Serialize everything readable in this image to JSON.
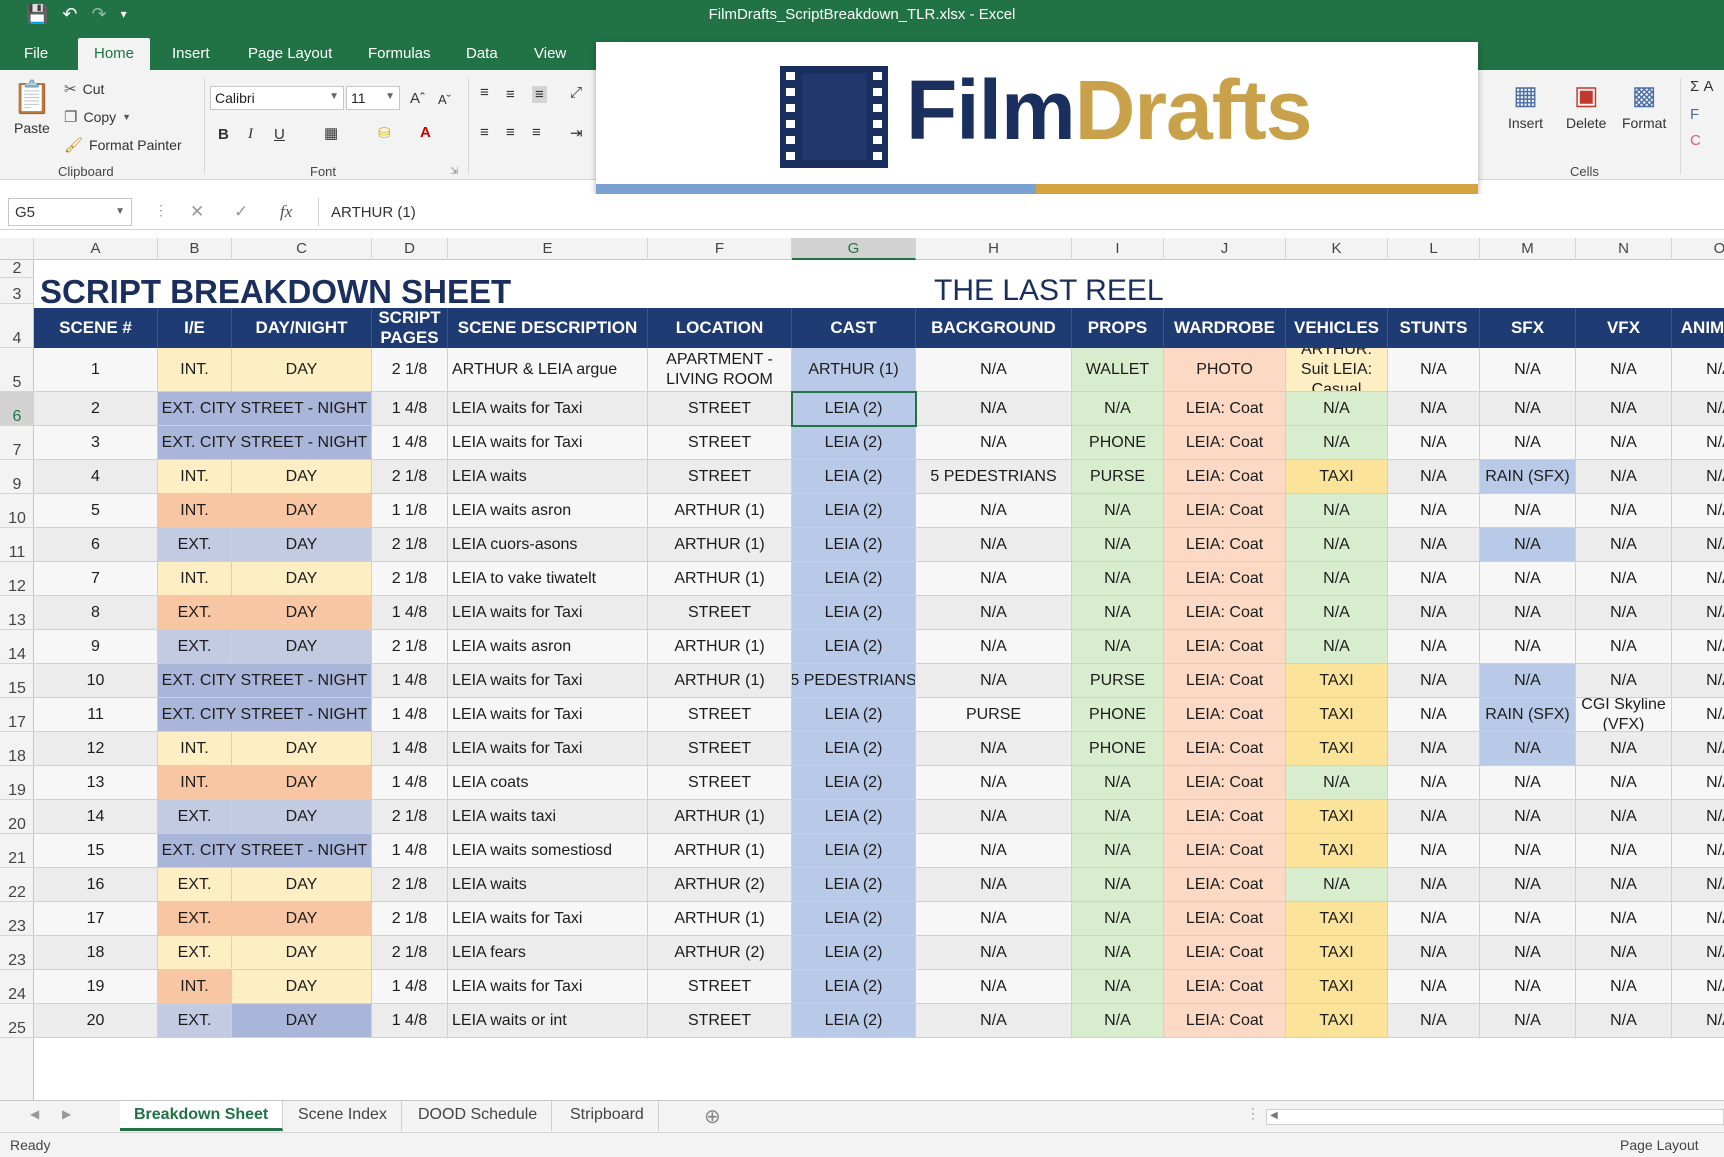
{
  "window": {
    "title": "FilmDrafts_ScriptBreakdown_TLR.xlsx - Excel"
  },
  "quick_access": {
    "save_icon": "save-icon",
    "undo_icon": "undo-icon",
    "redo_icon": "redo-icon",
    "customize_icon": "customize-icon"
  },
  "ribbon_tabs": [
    "File",
    "Home",
    "Insert",
    "Page Layout",
    "Formulas",
    "Data",
    "View"
  ],
  "ribbon": {
    "paste": "Paste",
    "cut": "Cut",
    "copy": "Copy",
    "format_painter": "Format Painter",
    "clipboard_group": "Clipboard",
    "font_name": "Calibri",
    "font_size": "11",
    "font_group": "Font",
    "bold": "B",
    "italic": "I",
    "underline": "U",
    "insert": "Insert",
    "delete": "Delete",
    "format": "Format",
    "cells_group": "Cells",
    "sum": "Σ A",
    "fill": "F",
    "clear": "C"
  },
  "logo": {
    "film": "Film",
    "drafts": "Drafts",
    "film_color": "#1b2f5e",
    "drafts_color": "#c9a14a",
    "bar_left_color": "#7aa1cf",
    "bar_right_color": "#d4a340"
  },
  "formula_bar": {
    "name_box": "G5",
    "fx": "fx",
    "formula": "ARTHUR (1)"
  },
  "columns": [
    "A",
    "B",
    "C",
    "D",
    "E",
    "F",
    "G",
    "H",
    "I",
    "J",
    "K",
    "L",
    "M",
    "N",
    "O"
  ],
  "selected_column": "G",
  "row_numbers": [
    "2",
    "3",
    "4",
    "5",
    "6",
    "7",
    "9",
    "10",
    "11",
    "12",
    "13",
    "14",
    "15",
    "17",
    "18",
    "19",
    "20",
    "21",
    "22",
    "23",
    "23",
    "24",
    "25"
  ],
  "selected_row": "6",
  "sheet": {
    "title": "SCRIPT BREAKDOWN SHEET",
    "production": "THE LAST REEL",
    "headers": [
      "SCENE #",
      "I/E",
      "DAY/NIGHT",
      "SCRIPT PAGES",
      "SCENE DESCRIPTION",
      "LOCATION",
      "CAST",
      "BACKGROUND",
      "PROPS",
      "WARDROBE",
      "VEHICLES",
      "STUNTS",
      "SFX",
      "VFX",
      "ANIMALS"
    ],
    "rows": [
      {
        "scene": "1",
        "ie": "INT.",
        "dn": "DAY",
        "pages": "2 1/8",
        "desc": "ARTHUR & LEIA argue",
        "loc": "APARTMENT - LIVING ROOM",
        "cast": "ARTHUR (1)",
        "bg": "N/A",
        "props": "WALLET",
        "ward": "PHOTO",
        "veh": "ARTHUR: Suit LEIA: Casual",
        "stunts": "N/A",
        "sfx": "N/A",
        "vfx": "N/A",
        "animals": "N/A",
        "ie_color": "#fdeec3",
        "dn_color": "#fdeec3",
        "veh_color": "#fdeec3",
        "sfx_color": ""
      },
      {
        "scene": "2",
        "ie": "EXT. CITY STREET - NIGHT",
        "dn": "",
        "pages": "1 4/8",
        "desc": "LEIA waits for Taxi",
        "loc": "STREET",
        "cast": "LEIA (2)",
        "bg": "N/A",
        "props": "N/A",
        "ward": "LEIA: Coat",
        "veh": "N/A",
        "stunts": "N/A",
        "sfx": "N/A",
        "vfx": "N/A",
        "animals": "N/A",
        "ie_color": "#a9b6da",
        "dn_color": "#a9b6da",
        "veh_color": "#d8ecce",
        "sfx_color": ""
      },
      {
        "scene": "3",
        "ie": "EXT. CITY STREET - NIGHT",
        "dn": "",
        "pages": "1 4/8",
        "desc": "LEIA waits for Taxi",
        "loc": "STREET",
        "cast": "LEIA (2)",
        "bg": "N/A",
        "props": "PHONE",
        "ward": "LEIA: Coat",
        "veh": "N/A",
        "stunts": "N/A",
        "sfx": "N/A",
        "vfx": "N/A",
        "animals": "N/A",
        "ie_color": "#a9b6da",
        "dn_color": "#a9b6da",
        "veh_color": "#d8ecce",
        "sfx_color": ""
      },
      {
        "scene": "4",
        "ie": "INT.",
        "dn": "DAY",
        "pages": "2 1/8",
        "desc": "LEIA waits",
        "loc": "STREET",
        "cast": "LEIA (2)",
        "bg": "5 PEDESTRIANS",
        "props": "PURSE",
        "ward": "LEIA: Coat",
        "veh": "TAXI",
        "stunts": "N/A",
        "sfx": "RAIN (SFX)",
        "vfx": "N/A",
        "animals": "N/A",
        "ie_color": "#fdeec3",
        "dn_color": "#fdeec3",
        "veh_color": "#fbe49a",
        "sfx_color": "#b9c9e8"
      },
      {
        "scene": "5",
        "ie": "INT.",
        "dn": "DAY",
        "pages": "1 1/8",
        "desc": "LEIA waits asron",
        "loc": "ARTHUR (1)",
        "cast": "LEIA (2)",
        "bg": "N/A",
        "props": "N/A",
        "ward": "LEIA: Coat",
        "veh": "N/A",
        "stunts": "N/A",
        "sfx": "N/A",
        "vfx": "N/A",
        "animals": "N/A",
        "ie_color": "#f8c6a3",
        "dn_color": "#f8c6a3",
        "veh_color": "#d8ecce",
        "sfx_color": ""
      },
      {
        "scene": "6",
        "ie": "EXT.",
        "dn": "DAY",
        "pages": "2 1/8",
        "desc": "LEIA cuors-asons",
        "loc": "ARTHUR (1)",
        "cast": "LEIA (2)",
        "bg": "N/A",
        "props": "N/A",
        "ward": "LEIA: Coat",
        "veh": "N/A",
        "stunts": "N/A",
        "sfx": "N/A",
        "vfx": "N/A",
        "animals": "N/A",
        "ie_color": "#c3cbe2",
        "dn_color": "#c3cbe2",
        "veh_color": "#d8ecce",
        "sfx_color": "#b9c9e8"
      },
      {
        "scene": "7",
        "ie": "INT.",
        "dn": "DAY",
        "pages": "2 1/8",
        "desc": "LEIA to vake tiwatelt",
        "loc": "ARTHUR (1)",
        "cast": "LEIA (2)",
        "bg": "N/A",
        "props": "N/A",
        "ward": "LEIA: Coat",
        "veh": "N/A",
        "stunts": "N/A",
        "sfx": "N/A",
        "vfx": "N/A",
        "animals": "N/A",
        "ie_color": "#fdeec3",
        "dn_color": "#fdeec3",
        "veh_color": "#d8ecce",
        "sfx_color": ""
      },
      {
        "scene": "8",
        "ie": "EXT.",
        "dn": "DAY",
        "pages": "1 4/8",
        "desc": "LEIA waits for Taxi",
        "loc": "STREET",
        "cast": "LEIA (2)",
        "bg": "N/A",
        "props": "N/A",
        "ward": "LEIA: Coat",
        "veh": "N/A",
        "stunts": "N/A",
        "sfx": "N/A",
        "vfx": "N/A",
        "animals": "N/A",
        "ie_color": "#f8c6a3",
        "dn_color": "#f8c6a3",
        "veh_color": "#d8ecce",
        "sfx_color": ""
      },
      {
        "scene": "9",
        "ie": "EXT.",
        "dn": "DAY",
        "pages": "2 1/8",
        "desc": "LEIA waits asron",
        "loc": "ARTHUR (1)",
        "cast": "LEIA (2)",
        "bg": "N/A",
        "props": "N/A",
        "ward": "LEIA: Coat",
        "veh": "N/A",
        "stunts": "N/A",
        "sfx": "N/A",
        "vfx": "N/A",
        "animals": "N/A",
        "ie_color": "#c3cbe2",
        "dn_color": "#c3cbe2",
        "veh_color": "#d8ecce",
        "sfx_color": ""
      },
      {
        "scene": "10",
        "ie": "EXT. CITY STREET - NIGHT",
        "dn": "",
        "pages": "1 4/8",
        "desc": "LEIA waits for Taxi",
        "loc": "ARTHUR (1)",
        "cast": "5 PEDESTRIANS",
        "bg": "N/A",
        "props": "PURSE",
        "ward": "LEIA: Coat",
        "veh": "TAXI",
        "stunts": "N/A",
        "sfx": "N/A",
        "vfx": "N/A",
        "animals": "N/A",
        "ie_color": "#a9b6da",
        "dn_color": "#a9b6da",
        "veh_color": "#fbe49a",
        "sfx_color": "#b9c9e8"
      },
      {
        "scene": "11",
        "ie": "EXT. CITY STREET - NIGHT",
        "dn": "",
        "pages": "1 4/8",
        "desc": "LEIA waits for Taxi",
        "loc": "STREET",
        "cast": "LEIA (2)",
        "bg": "PURSE",
        "props": "PHONE",
        "ward": "LEIA: Coat",
        "veh": "TAXI",
        "stunts": "N/A",
        "sfx": "RAIN (SFX)",
        "vfx": "CGI Skyline (VFX)",
        "animals": "N/A",
        "ie_color": "#a9b6da",
        "dn_color": "#a9b6da",
        "veh_color": "#fbe49a",
        "sfx_color": "#b9c9e8"
      },
      {
        "scene": "12",
        "ie": "INT.",
        "dn": "DAY",
        "pages": "1 4/8",
        "desc": "LEIA waits for Taxi",
        "loc": "STREET",
        "cast": "LEIA (2)",
        "bg": "N/A",
        "props": "PHONE",
        "ward": "LEIA: Coat",
        "veh": "TAXI",
        "stunts": "N/A",
        "sfx": "N/A",
        "vfx": "N/A",
        "animals": "N/A",
        "ie_color": "#fdeec3",
        "dn_color": "#fdeec3",
        "veh_color": "#fbe49a",
        "sfx_color": "#b9c9e8"
      },
      {
        "scene": "13",
        "ie": "INT.",
        "dn": "DAY",
        "pages": "1 4/8",
        "desc": "LEIA coats",
        "loc": "STREET",
        "cast": "LEIA (2)",
        "bg": "N/A",
        "props": "N/A",
        "ward": "LEIA: Coat",
        "veh": "N/A",
        "stunts": "N/A",
        "sfx": "N/A",
        "vfx": "N/A",
        "animals": "N/A",
        "ie_color": "#f8c6a3",
        "dn_color": "#f8c6a3",
        "veh_color": "#d8ecce",
        "sfx_color": ""
      },
      {
        "scene": "14",
        "ie": "EXT.",
        "dn": "DAY",
        "pages": "2 1/8",
        "desc": "LEIA waits taxi",
        "loc": "ARTHUR (1)",
        "cast": "LEIA (2)",
        "bg": "N/A",
        "props": "N/A",
        "ward": "LEIA: Coat",
        "veh": "TAXI",
        "stunts": "N/A",
        "sfx": "N/A",
        "vfx": "N/A",
        "animals": "N/A",
        "ie_color": "#c3cbe2",
        "dn_color": "#c3cbe2",
        "veh_color": "#fbe49a",
        "sfx_color": ""
      },
      {
        "scene": "15",
        "ie": "EXT. CITY STREET - NIGHT",
        "dn": "",
        "pages": "1 4/8",
        "desc": "LEIA waits somestiosd",
        "loc": "ARTHUR (1)",
        "cast": "LEIA (2)",
        "bg": "N/A",
        "props": "N/A",
        "ward": "LEIA: Coat",
        "veh": "TAXI",
        "stunts": "N/A",
        "sfx": "N/A",
        "vfx": "N/A",
        "animals": "N/A",
        "ie_color": "#a9b6da",
        "dn_color": "#a9b6da",
        "veh_color": "#fbe49a",
        "sfx_color": ""
      },
      {
        "scene": "16",
        "ie": "EXT.",
        "dn": "DAY",
        "pages": "2 1/8",
        "desc": "LEIA waits",
        "loc": "ARTHUR (2)",
        "cast": "LEIA (2)",
        "bg": "N/A",
        "props": "N/A",
        "ward": "LEIA: Coat",
        "veh": "N/A",
        "stunts": "N/A",
        "sfx": "N/A",
        "vfx": "N/A",
        "animals": "N/A",
        "ie_color": "#fdeec3",
        "dn_color": "#fdeec3",
        "veh_color": "#d8ecce",
        "sfx_color": ""
      },
      {
        "scene": "17",
        "ie": "EXT.",
        "dn": "DAY",
        "pages": "2 1/8",
        "desc": "LEIA waits for Taxi",
        "loc": "ARTHUR (1)",
        "cast": "LEIA (2)",
        "bg": "N/A",
        "props": "N/A",
        "ward": "LEIA: Coat",
        "veh": "TAXI",
        "stunts": "N/A",
        "sfx": "N/A",
        "vfx": "N/A",
        "animals": "N/A",
        "ie_color": "#f8c6a3",
        "dn_color": "#f8c6a3",
        "veh_color": "#fbe49a",
        "sfx_color": ""
      },
      {
        "scene": "18",
        "ie": "EXT.",
        "dn": "DAY",
        "pages": "2 1/8",
        "desc": "LEIA fears",
        "loc": "ARTHUR (2)",
        "cast": "LEIA (2)",
        "bg": "N/A",
        "props": "N/A",
        "ward": "LEIA: Coat",
        "veh": "TAXI",
        "stunts": "N/A",
        "sfx": "N/A",
        "vfx": "N/A",
        "animals": "N/A",
        "ie_color": "#fdeec3",
        "dn_color": "#fdeec3",
        "veh_color": "#fbe49a",
        "sfx_color": ""
      },
      {
        "scene": "19",
        "ie": "INT.",
        "dn": "DAY",
        "pages": "1 4/8",
        "desc": "LEIA waits for Taxi",
        "loc": "STREET",
        "cast": "LEIA (2)",
        "bg": "N/A",
        "props": "N/A",
        "ward": "LEIA: Coat",
        "veh": "TAXI",
        "stunts": "N/A",
        "sfx": "N/A",
        "vfx": "N/A",
        "animals": "N/A",
        "ie_color": "#f8c6a3",
        "dn_color": "#fdeec3",
        "veh_color": "#fbe49a",
        "sfx_color": ""
      },
      {
        "scene": "20",
        "ie": "EXT.",
        "dn": "DAY",
        "pages": "1 4/8",
        "desc": "LEIA waits or int",
        "loc": "STREET",
        "cast": "LEIA (2)",
        "bg": "N/A",
        "props": "N/A",
        "ward": "LEIA: Coat",
        "veh": "TAXI",
        "stunts": "N/A",
        "sfx": "N/A",
        "vfx": "N/A",
        "animals": "N/A",
        "ie_color": "#c3cbe2",
        "dn_color": "#a9b6da",
        "veh_color": "#fbe49a",
        "sfx_color": ""
      }
    ],
    "cast_color": "#b9c9e8",
    "props_color": "#d8ecce",
    "wardrobe_color": "#fbd9c4",
    "header_color": "#1f3b73"
  },
  "sheet_tabs": [
    "Breakdown Sheet",
    "Scene Index",
    "DOOD Schedule",
    "Stripboard"
  ],
  "active_sheet": "Breakdown Sheet",
  "status": {
    "ready": "Ready",
    "view": "Page Layout"
  }
}
